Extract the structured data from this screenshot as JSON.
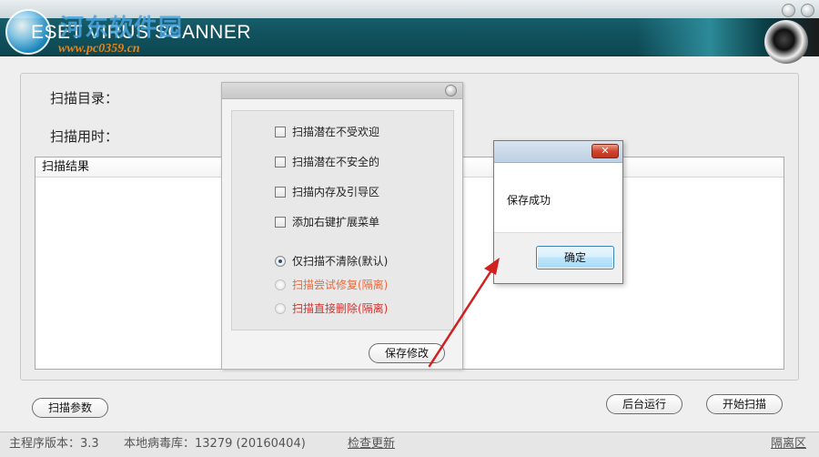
{
  "window": {
    "title": "ESET VIRUS SCANNER",
    "watermark_cn": "河东软件园",
    "watermark_url": "www.pc0359.cn"
  },
  "main": {
    "scan_dir_label": "扫描目录：",
    "scan_time_label": "扫描用时：",
    "results_header": "扫描结果"
  },
  "buttons": {
    "scan_params": "扫描参数",
    "background_run": "后台运行",
    "start_scan": "开始扫描"
  },
  "status": {
    "program_version": "主程序版本：3.3",
    "virus_db": "本地病毒库：13279 (20160404)",
    "check_update": "检查更新",
    "quarantine": "隔离区"
  },
  "options_dialog": {
    "checkboxes": [
      {
        "label": "扫描潜在不受欢迎",
        "checked": false
      },
      {
        "label": "扫描潜在不安全的",
        "checked": false
      },
      {
        "label": "扫描内存及引导区",
        "checked": false
      },
      {
        "label": "添加右键扩展菜单",
        "checked": false
      }
    ],
    "radios": [
      {
        "label": "仅扫描不清除(默认)",
        "selected": true,
        "color": "#222222"
      },
      {
        "label": "扫描尝试修复(隔离)",
        "selected": false,
        "color": "#e96a3e"
      },
      {
        "label": "扫描直接删除(隔离)",
        "selected": false,
        "color": "#d8312c"
      }
    ],
    "save_button": "保存修改"
  },
  "message_box": {
    "close_symbol": "✕",
    "message": "保存成功",
    "ok_button": "确定"
  },
  "colors": {
    "title_bar": "#125460",
    "arrow": "#d0201f"
  }
}
